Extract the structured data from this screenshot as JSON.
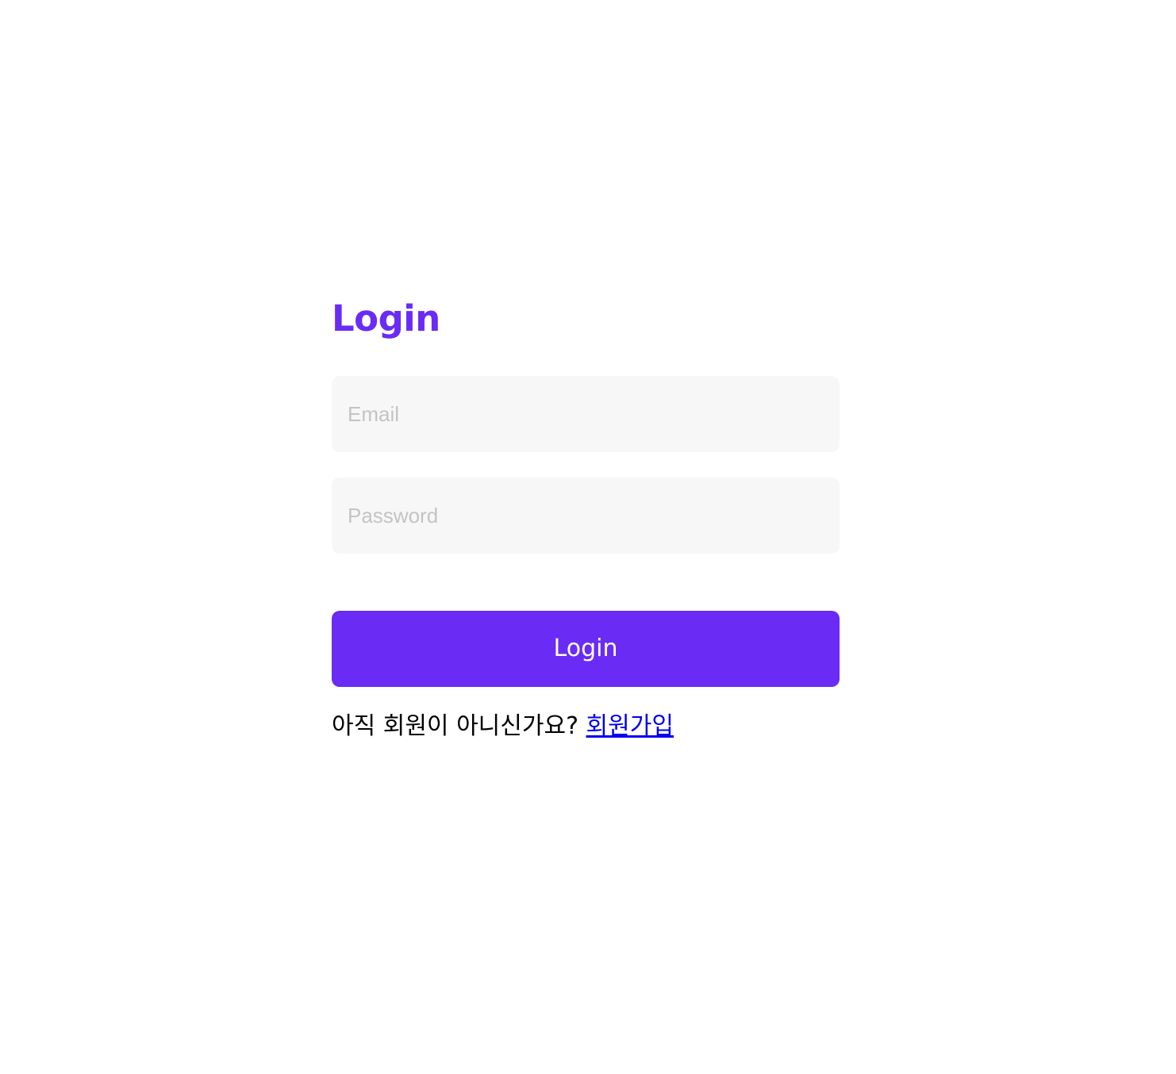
{
  "login": {
    "title": "Login",
    "email": {
      "value": "",
      "placeholder": "Email"
    },
    "password": {
      "value": "",
      "placeholder": "Password"
    },
    "submit_label": "Login",
    "signup_prompt": "아직 회원이 아니신가요? ",
    "signup_link": "회원가입"
  },
  "colors": {
    "accent": "#6a2bf5",
    "field_background": "#f7f7f7",
    "placeholder": "#c4c4c4",
    "link": "#0000ee"
  }
}
